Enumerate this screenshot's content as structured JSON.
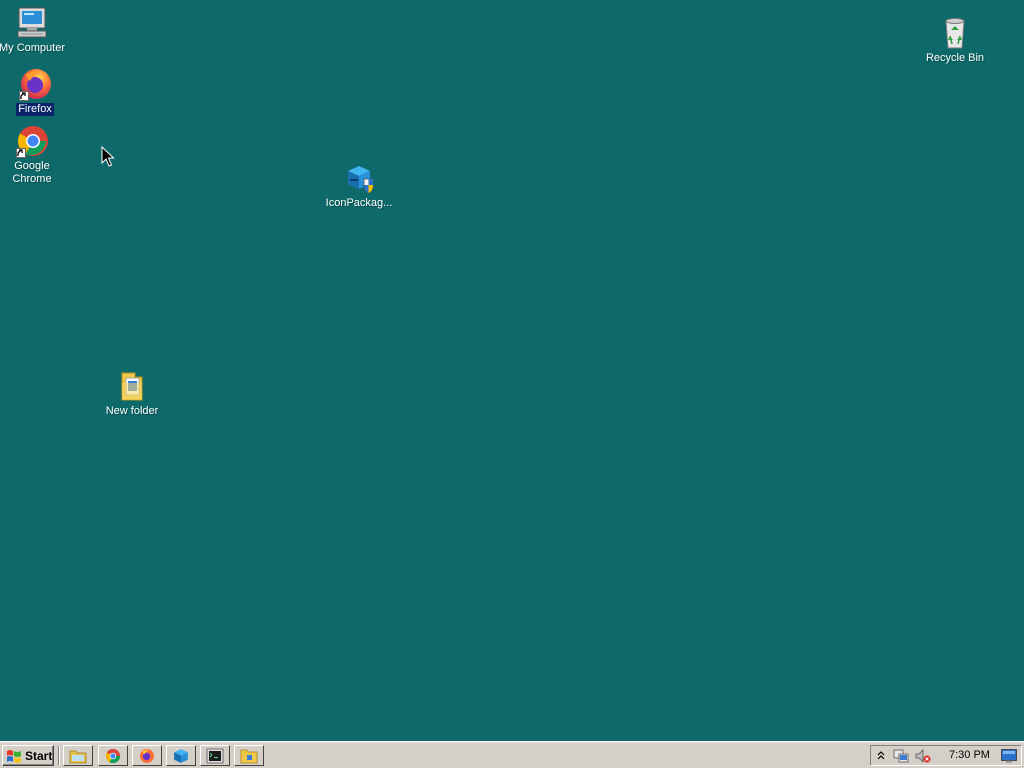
{
  "desktop": {
    "background": "#0e6a6a",
    "icons": {
      "my_computer": "My Computer",
      "firefox": "Firefox",
      "chrome": "Google Chrome",
      "iconpackager": "IconPackag...",
      "new_folder": "New folder",
      "recycle_bin": "Recycle Bin"
    },
    "selected_icon": "firefox"
  },
  "taskbar": {
    "start_label": "Start",
    "quick_launch": [
      "explorer-icon",
      "chrome-icon",
      "firefox-icon",
      "iconpackager-icon",
      "terminal-icon",
      "folder-icon"
    ],
    "tray_icons": [
      "show-hidden-icons-chevron",
      "network-icon",
      "volume-muted-icon",
      "desktop-icon"
    ],
    "clock": "7:30 PM"
  }
}
